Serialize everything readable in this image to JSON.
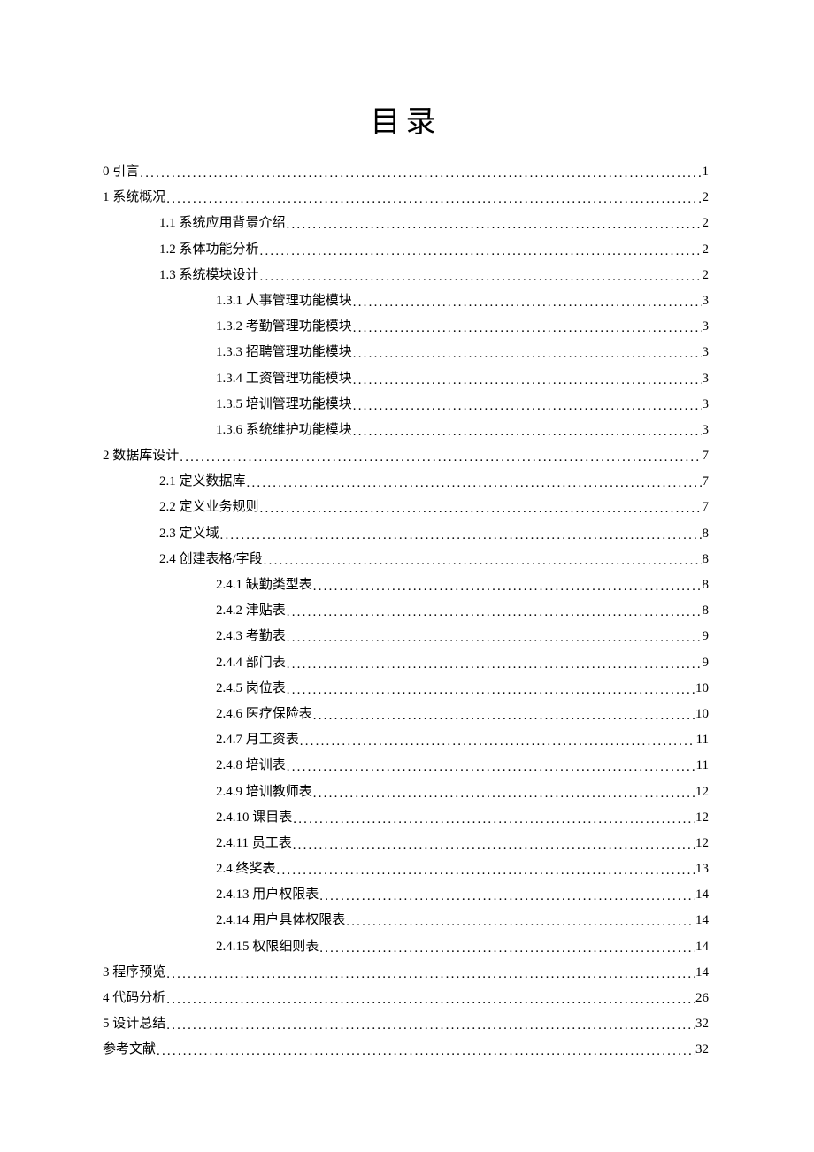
{
  "title": "目录",
  "entries": [
    {
      "level": 0,
      "label": "0 引言",
      "page": "1"
    },
    {
      "level": 0,
      "label": "1 系统概况",
      "page": "2"
    },
    {
      "level": 1,
      "label": "1.1 系统应用背景介绍",
      "page": "2"
    },
    {
      "level": 1,
      "label": "1.2 系体功能分析",
      "page": "2"
    },
    {
      "level": 1,
      "label": "1.3 系统模块设计",
      "page": "2"
    },
    {
      "level": 2,
      "label": "1.3.1 人事管理功能模块",
      "page": "3"
    },
    {
      "level": 2,
      "label": "1.3.2 考勤管理功能模块",
      "page": "3"
    },
    {
      "level": 2,
      "label": "1.3.3 招聘管理功能模块",
      "page": "3"
    },
    {
      "level": 2,
      "label": "1.3.4 工资管理功能模块",
      "page": "3"
    },
    {
      "level": 2,
      "label": "1.3.5 培训管理功能模块",
      "page": "3"
    },
    {
      "level": 2,
      "label": "1.3.6 系统维护功能模块",
      "page": "3"
    },
    {
      "level": 0,
      "label": "2 数据库设计",
      "page": "7"
    },
    {
      "level": 1,
      "label": "2.1 定义数据库",
      "page": "7"
    },
    {
      "level": 1,
      "label": "2.2 定义业务规则",
      "page": "7"
    },
    {
      "level": 1,
      "label": "2.3 定义域",
      "page": "8"
    },
    {
      "level": 1,
      "label": "2.4 创建表格/字段 ",
      "page": "8"
    },
    {
      "level": 2,
      "label": "2.4.1 缺勤类型表",
      "page": "8"
    },
    {
      "level": 2,
      "label": "2.4.2 津贴表",
      "page": "8"
    },
    {
      "level": 2,
      "label": "2.4.3 考勤表",
      "page": "9"
    },
    {
      "level": 2,
      "label": "2.4.4 部门表",
      "page": "9"
    },
    {
      "level": 2,
      "label": "2.4.5 岗位表",
      "page": "10"
    },
    {
      "level": 2,
      "label": "2.4.6 医疗保险表",
      "page": "10"
    },
    {
      "level": 2,
      "label": "2.4.7 月工资表",
      "page": "11"
    },
    {
      "level": 2,
      "label": "2.4.8 培训表",
      "page": "11"
    },
    {
      "level": 2,
      "label": "2.4.9 培训教师表",
      "page": "12"
    },
    {
      "level": 2,
      "label": "2.4.10 课目表",
      "page": "12"
    },
    {
      "level": 2,
      "label": "2.4.11 员工表",
      "page": "12"
    },
    {
      "level": 2,
      "label": "2.4.终奖表",
      "page": "13"
    },
    {
      "level": 2,
      "label": "2.4.13 用户权限表",
      "page": "14"
    },
    {
      "level": 2,
      "label": "2.4.14 用户具体权限表",
      "page": "14"
    },
    {
      "level": 2,
      "label": "2.4.15 权限细则表",
      "page": "14"
    },
    {
      "level": 0,
      "label": "3 程序预览",
      "page": "14"
    },
    {
      "level": 0,
      "label": "4 代码分析",
      "page": "26"
    },
    {
      "level": 0,
      "label": "5 设计总结",
      "page": "32"
    },
    {
      "level": 0,
      "label": "参考文献",
      "page": "32"
    }
  ]
}
